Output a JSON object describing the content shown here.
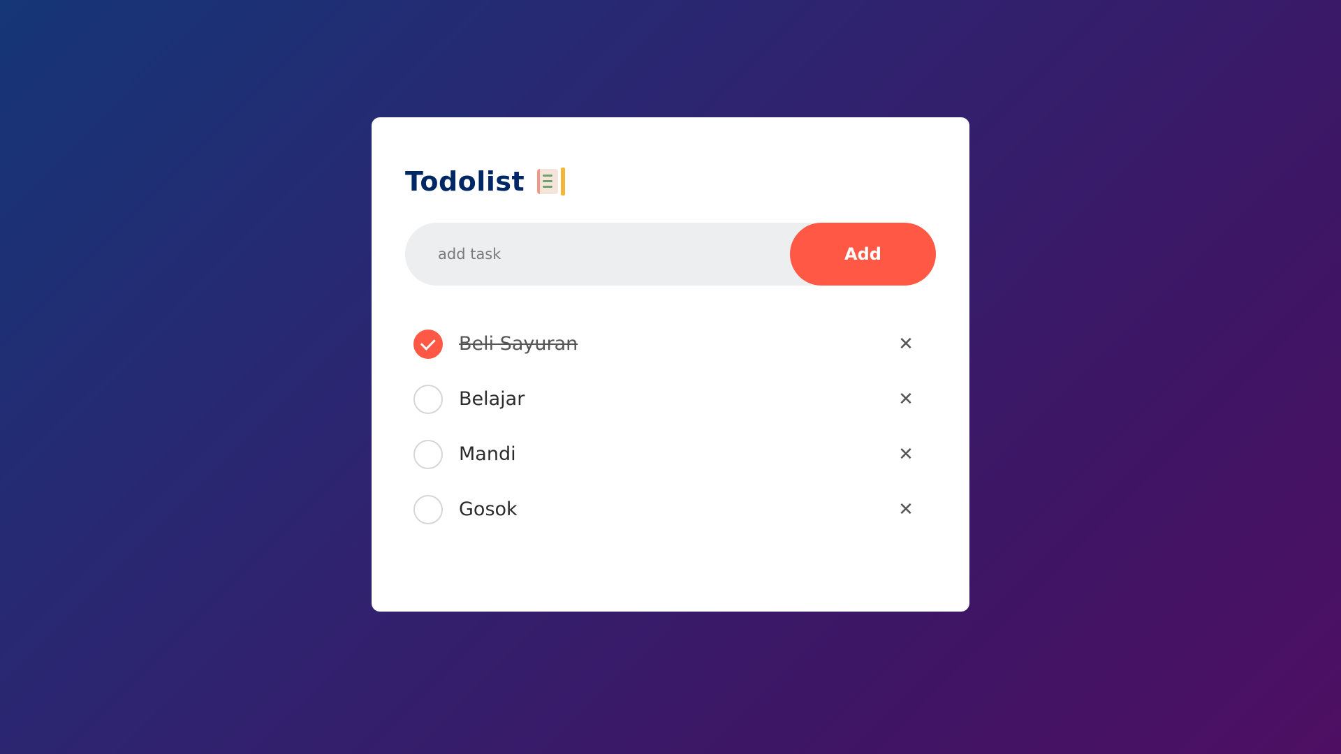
{
  "header": {
    "title": "Todolist",
    "icon": "notebook-checklist-icon"
  },
  "input": {
    "placeholder": "add task",
    "value": "",
    "add_label": "Add"
  },
  "tasks": [
    {
      "label": "Beli Sayuran",
      "done": true
    },
    {
      "label": "Belajar",
      "done": false
    },
    {
      "label": "Mandi",
      "done": false
    },
    {
      "label": "Gosok",
      "done": false
    }
  ],
  "delete_glyph": "✕",
  "colors": {
    "accent": "#ff5945",
    "title": "#002765",
    "input_bg": "#edeef0",
    "gradient_start": "#153677",
    "gradient_end": "#4e0f63"
  }
}
